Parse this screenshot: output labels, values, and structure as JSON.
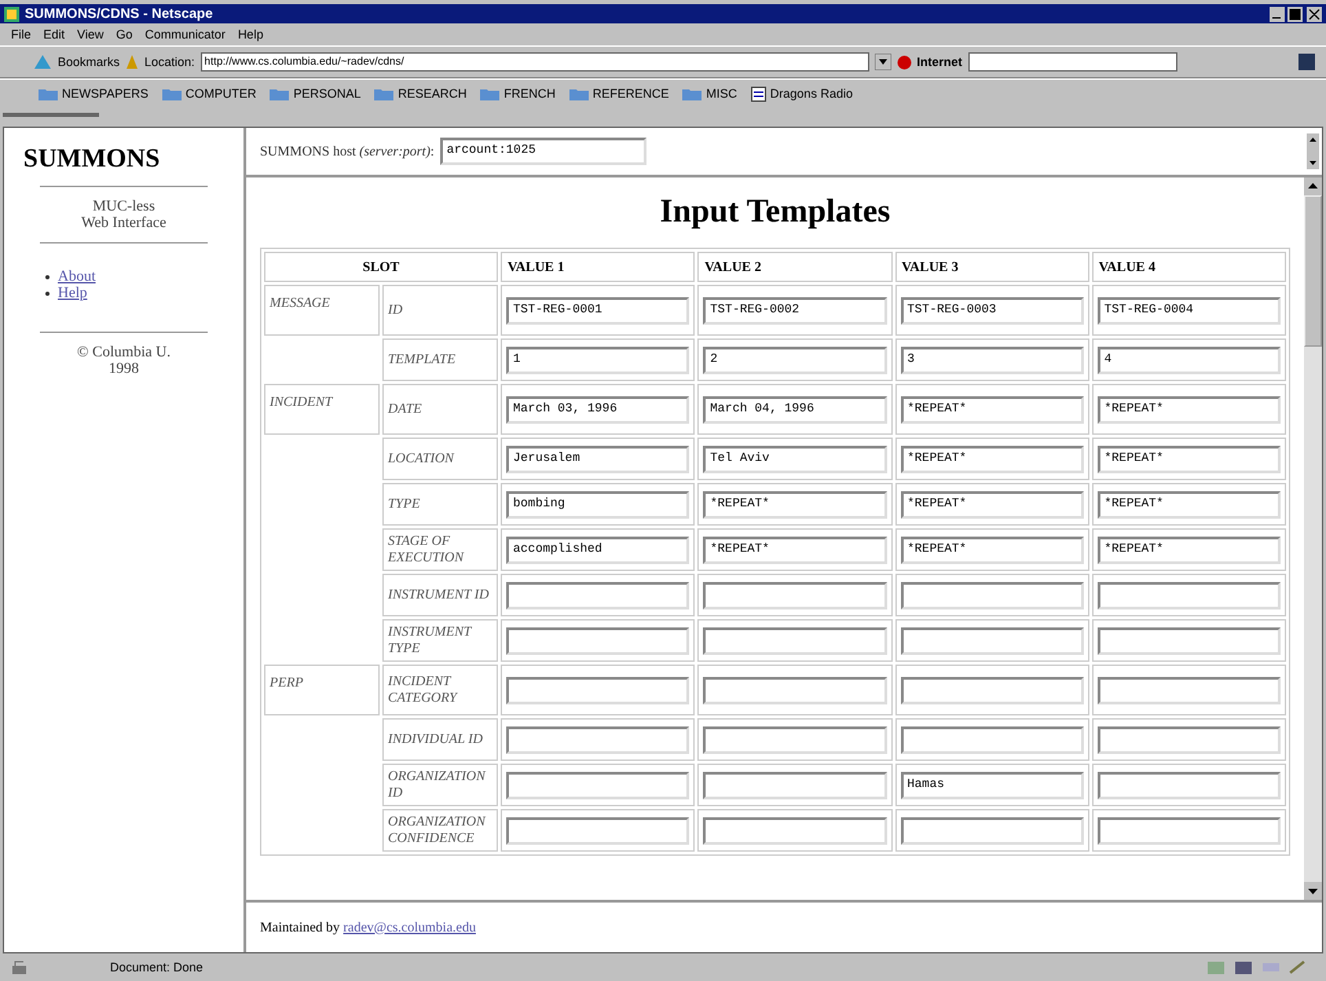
{
  "window": {
    "title": "SUMMONS/CDNS - Netscape"
  },
  "menu": [
    "File",
    "Edit",
    "View",
    "Go",
    "Communicator",
    "Help"
  ],
  "nav": {
    "bookmarks": "Bookmarks",
    "location_label": "Location:",
    "location": "http://www.cs.columbia.edu/~radev/cdns/",
    "related": "Internet"
  },
  "personal_toolbar": [
    {
      "label": "NEWSPAPERS",
      "kind": "folder"
    },
    {
      "label": "COMPUTER",
      "kind": "folder"
    },
    {
      "label": "PERSONAL",
      "kind": "folder"
    },
    {
      "label": "RESEARCH",
      "kind": "folder"
    },
    {
      "label": "FRENCH",
      "kind": "folder"
    },
    {
      "label": "REFERENCE",
      "kind": "folder"
    },
    {
      "label": "MISC",
      "kind": "folder"
    },
    {
      "label": "Dragons Radio",
      "kind": "page"
    }
  ],
  "sidebar": {
    "title": "SUMMONS",
    "subtitle": [
      "MUC-less",
      "Web Interface"
    ],
    "links": [
      "About",
      "Help"
    ],
    "copyright": [
      "© Columbia U.",
      "1998"
    ]
  },
  "host": {
    "label": "SUMMONS host ",
    "label_italic": "(server:port)",
    "label_end": ":",
    "value": "arcount:1025"
  },
  "heading": "Input Templates",
  "table": {
    "columns": [
      "SLOT",
      "VALUE 1",
      "VALUE 2",
      "VALUE 3",
      "VALUE 4"
    ],
    "rows": [
      {
        "group": "MESSAGE",
        "slot": "ID",
        "value_1": "TST-REG-0001",
        "value_2": "TST-REG-0002",
        "value_3": "TST-REG-0003",
        "value_4": "TST-REG-0004"
      },
      {
        "slot": "TEMPLATE",
        "value_1": "1",
        "value_2": "2",
        "value_3": "3",
        "value_4": "4"
      },
      {
        "group": "INCIDENT",
        "slot": "DATE",
        "value_1": "March 03, 1996",
        "value_2": "March 04, 1996",
        "value_3": "*REPEAT*",
        "value_4": "*REPEAT*"
      },
      {
        "slot": "LOCATION",
        "value_1": "Jerusalem",
        "value_2": "Tel Aviv",
        "value_3": "*REPEAT*",
        "value_4": "*REPEAT*"
      },
      {
        "slot": "TYPE",
        "value_1": "bombing",
        "value_2": "*REPEAT*",
        "value_3": "*REPEAT*",
        "value_4": "*REPEAT*"
      },
      {
        "slot": "STAGE OF EXECUTION",
        "value_1": "accomplished",
        "value_2": "*REPEAT*",
        "value_3": "*REPEAT*",
        "value_4": "*REPEAT*"
      },
      {
        "slot": "INSTRUMENT ID"
      },
      {
        "slot": "INSTRUMENT TYPE"
      },
      {
        "group": "PERP",
        "slot": "INCIDENT CATEGORY"
      },
      {
        "slot": "INDIVIDUAL ID"
      },
      {
        "slot": "ORGANIZATION ID",
        "value_3": "Hamas"
      },
      {
        "slot": "ORGANIZATION CONFIDENCE"
      }
    ]
  },
  "footer": {
    "label": "Maintained by ",
    "email": "radev@cs.columbia.edu"
  },
  "status_bar": {
    "text": "Document: Done"
  }
}
